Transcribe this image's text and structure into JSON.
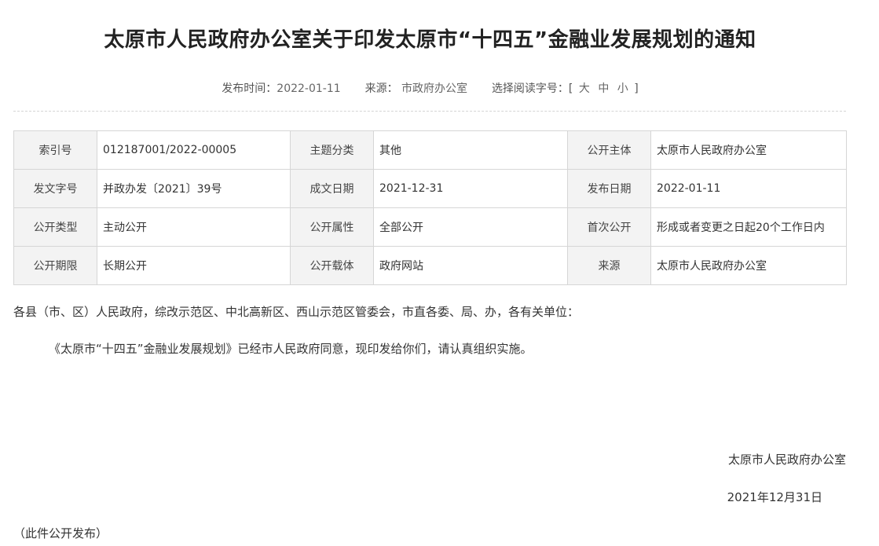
{
  "article": {
    "title": "太原市人民政府办公室关于印发太原市“十四五”金融业发展规划的通知",
    "meta": {
      "publish_time_label": "发布时间：",
      "publish_time": "2022-01-11",
      "source_label": "来源：",
      "source": "市政府办公室",
      "font_size_label": "选择阅读字号：[",
      "font_size_options": [
        "大",
        "中",
        "小"
      ],
      "font_size_close": "]"
    }
  },
  "info_table": [
    [
      {
        "key": "索引号",
        "value": "012187001/2022-00005"
      },
      {
        "key": "主题分类",
        "value": "其他"
      },
      {
        "key": "公开主体",
        "value": "太原市人民政府办公室"
      }
    ],
    [
      {
        "key": "发文字号",
        "value": "并政办发〔2021〕39号"
      },
      {
        "key": "成文日期",
        "value": "2021-12-31"
      },
      {
        "key": "发布日期",
        "value": "2022-01-11"
      }
    ],
    [
      {
        "key": "公开类型",
        "value": "主动公开"
      },
      {
        "key": "公开属性",
        "value": "全部公开"
      },
      {
        "key": "首次公开",
        "value": "形成或者变更之日起20个工作日内"
      }
    ],
    [
      {
        "key": "公开期限",
        "value": "长期公开"
      },
      {
        "key": "公开载体",
        "value": "政府网站"
      },
      {
        "key": "来源",
        "value": "太原市人民政府办公室"
      }
    ]
  ],
  "content": {
    "salutation": "各县（市、区）人民政府，综改示范区、中北高新区、西山示范区管委会，市直各委、局、办，各有关单位：",
    "paragraph": "《太原市“十四五”金融业发展规划》已经市人民政府同意，现印发给你们，请认真组织实施。",
    "signature": "太原市人民政府办公室",
    "date": "2021年12月31日",
    "note": "（此件公开发布）"
  }
}
